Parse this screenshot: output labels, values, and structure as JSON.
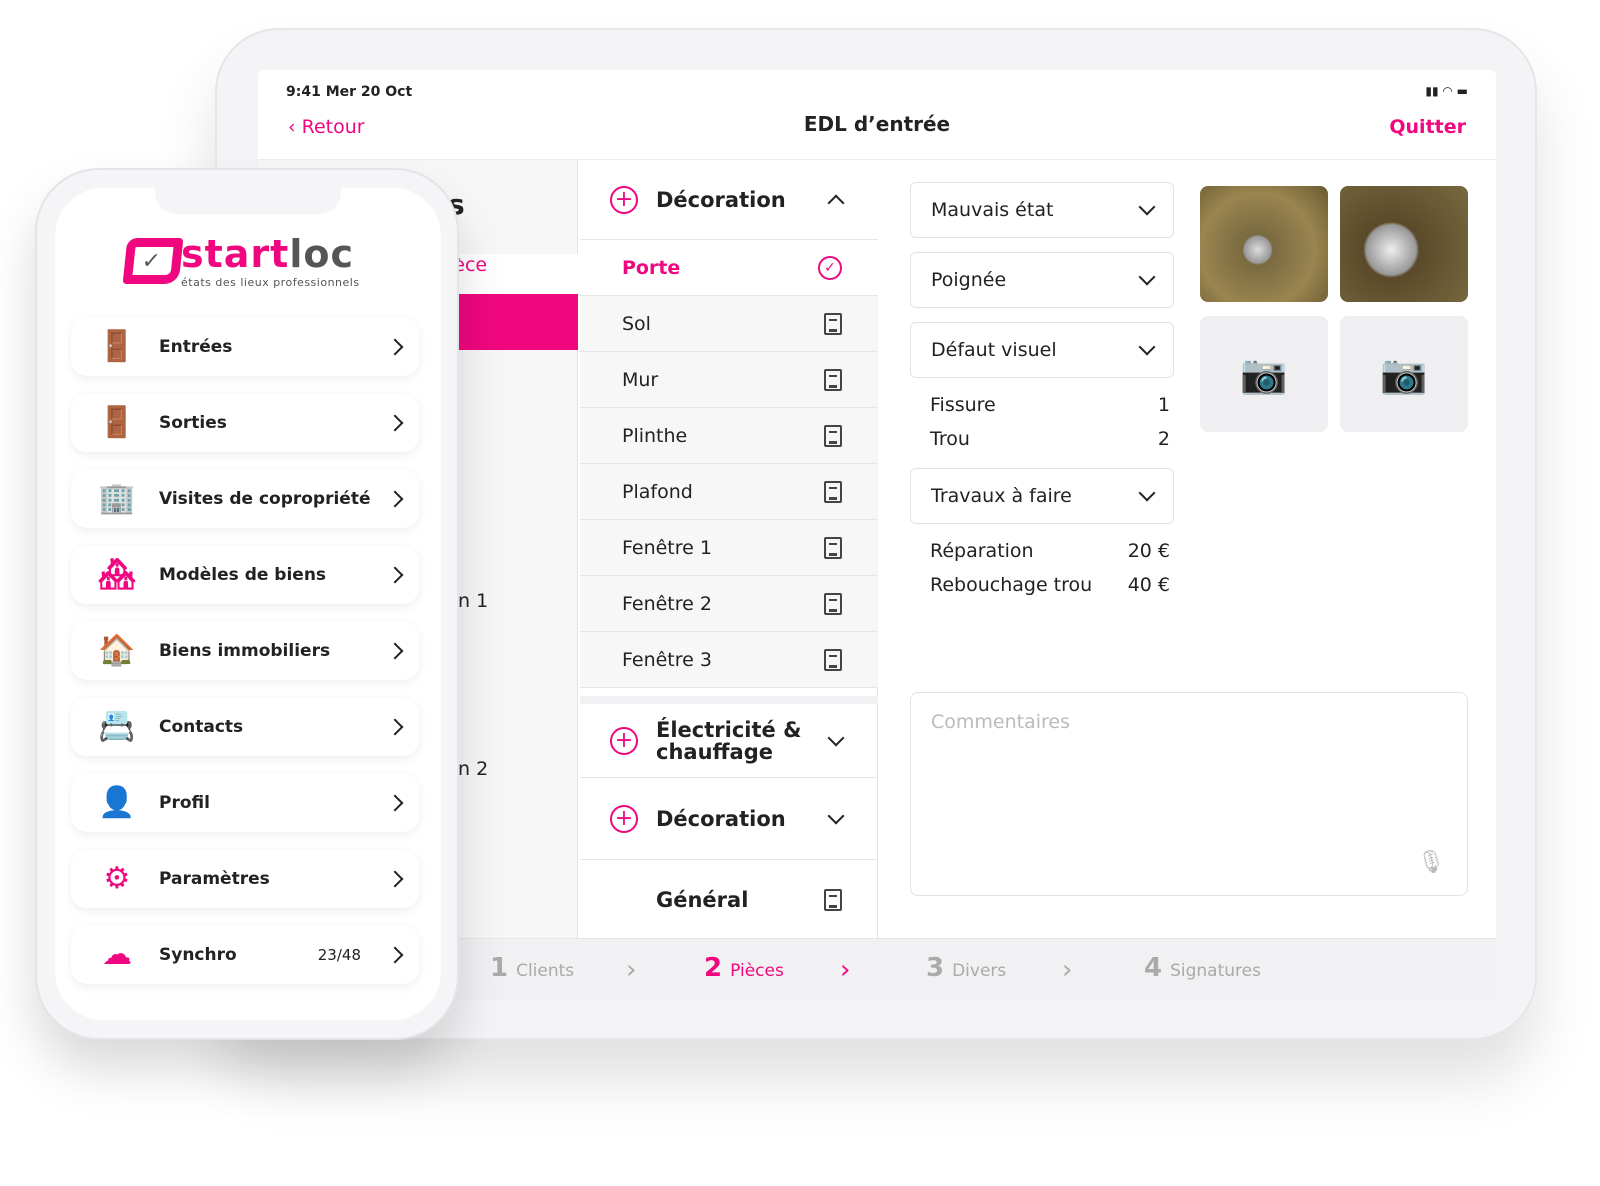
{
  "colors": {
    "accent": "#f0077f"
  },
  "tablet": {
    "status_time": "9:41 Mer 20 Oct",
    "back_label": "Retour",
    "title": "EDL d’entrée",
    "quit_label": "Quitter",
    "left_col": {
      "title_fragment": "s",
      "active_fragment": "ièce",
      "row_1": "n 1",
      "row_2": "n 2"
    },
    "middle": {
      "section_open": "Décoration",
      "items": [
        {
          "label": "Porte",
          "icon": "check-circle-icon"
        },
        {
          "label": "Sol",
          "icon": "document-icon"
        },
        {
          "label": "Mur",
          "icon": "document-icon"
        },
        {
          "label": "Plinthe",
          "icon": "document-icon"
        },
        {
          "label": "Plafond",
          "icon": "document-icon"
        },
        {
          "label": "Fenêtre  1",
          "icon": "document-icon"
        },
        {
          "label": "Fenêtre  2",
          "icon": "document-icon"
        },
        {
          "label": "Fenêtre  3",
          "icon": "document-icon"
        }
      ],
      "section_2": "Électricité & chauffage",
      "section_3": "Décoration",
      "general": "Général"
    },
    "detail": {
      "state_select": "Mauvais état",
      "element_select": "Poignée",
      "defect_select": "Défaut visuel",
      "defects": [
        {
          "label": "Fissure",
          "value": "1"
        },
        {
          "label": "Trou",
          "value": "2"
        }
      ],
      "works_select": "Travaux à faire",
      "works": [
        {
          "label": "Réparation",
          "value": "20 €"
        },
        {
          "label": "Rebouchage trou",
          "value": "40 €"
        }
      ],
      "comments_placeholder": "Commentaires"
    },
    "steps": [
      {
        "num": "1",
        "label": "Clients"
      },
      {
        "num": "2",
        "label": "Pièces"
      },
      {
        "num": "3",
        "label": "Divers"
      },
      {
        "num": "4",
        "label": "Signatures"
      }
    ]
  },
  "phone": {
    "logo": "startloc",
    "tagline": "états des lieux professionnels",
    "menu": [
      {
        "label": "Entrées",
        "icon": "door-enter-icon"
      },
      {
        "label": "Sorties",
        "icon": "door-exit-icon"
      },
      {
        "label": "Visites de copropriété",
        "icon": "building-visit-icon"
      },
      {
        "label": "Modèles de biens",
        "icon": "house-templates-icon"
      },
      {
        "label": "Biens immobiliers",
        "icon": "house-icon"
      },
      {
        "label": "Contacts",
        "icon": "contact-card-icon"
      },
      {
        "label": "Profil",
        "icon": "user-icon"
      },
      {
        "label": "Paramètres",
        "icon": "gears-icon"
      },
      {
        "label": "Synchro",
        "icon": "cloud-sync-icon",
        "count": "23/48"
      }
    ]
  }
}
